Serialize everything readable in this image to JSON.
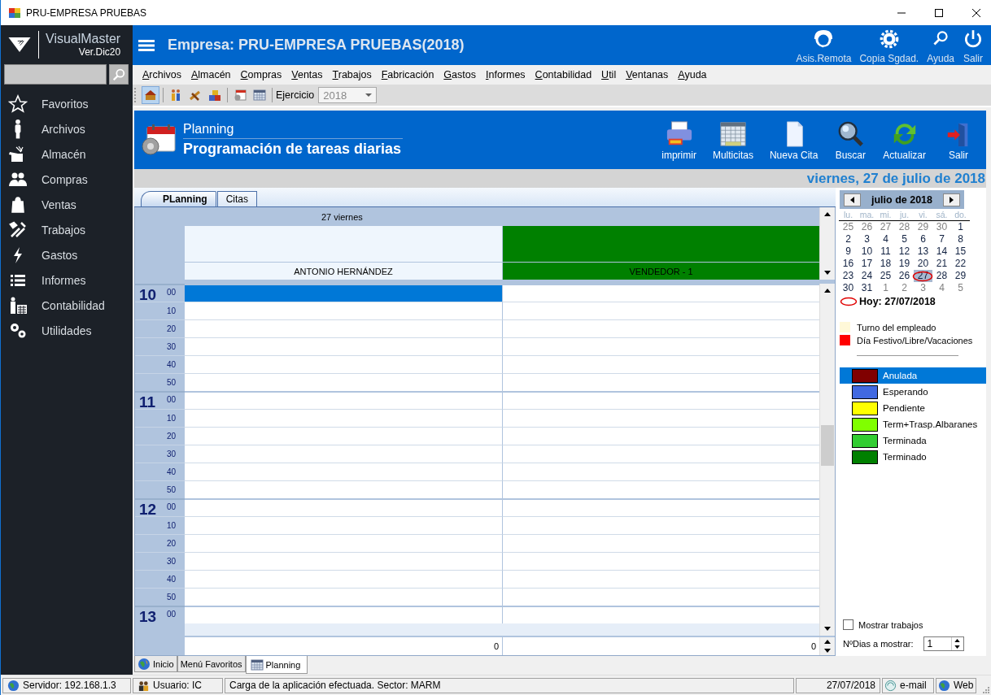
{
  "window": {
    "title": "PRU-EMPRESA PRUEBAS"
  },
  "sidebar": {
    "brand": "VisualMaster",
    "version": "Ver.Dic20",
    "items": [
      {
        "label": "Favoritos"
      },
      {
        "label": "Archivos"
      },
      {
        "label": "Almacén"
      },
      {
        "label": "Compras"
      },
      {
        "label": "Ventas"
      },
      {
        "label": "Trabajos"
      },
      {
        "label": "Gastos"
      },
      {
        "label": "Informes"
      },
      {
        "label": "Contabilidad"
      },
      {
        "label": "Utilidades"
      }
    ]
  },
  "header": {
    "title": "Empresa: PRU-EMPRESA PRUEBAS(2018)",
    "actions": [
      {
        "label": "Asis.Remota"
      },
      {
        "label": "Copia Sgdad."
      },
      {
        "label": "Ayuda"
      },
      {
        "label": "Salir"
      }
    ]
  },
  "menu": [
    "Archivos",
    "Almacén",
    "Compras",
    "Ventas",
    "Trabajos",
    "Fabricación",
    "Gastos",
    "Informes",
    "Contabilidad",
    "Util",
    "Ventanas",
    "Ayuda"
  ],
  "toolbar": {
    "label": "Ejercicio",
    "value": "2018"
  },
  "planning": {
    "subtitle": "Planning",
    "title": "Programación de tareas diarias",
    "date": "viernes, 27 de julio de 2018",
    "actions": [
      {
        "label": "imprimir"
      },
      {
        "label": "Multicitas"
      },
      {
        "label": "Nueva Cita"
      },
      {
        "label": "Buscar"
      },
      {
        "label": "Actualizar"
      },
      {
        "label": "Salir"
      }
    ]
  },
  "tabs": [
    {
      "label": "PLanning",
      "selected": true
    },
    {
      "label": "Citas",
      "selected": false
    }
  ],
  "schedule": {
    "day": "27 viernes",
    "resources": [
      {
        "name": "ANTONIO HERNÁNDEZ",
        "color": "#eff6fd"
      },
      {
        "name": "VENDEDOR - 1",
        "color": "#008000"
      }
    ],
    "hours": [
      {
        "hour": "10",
        "slots": [
          {
            "minute": "00",
            "cells": [
              {
                "selected": true
              },
              {
                "selected": false
              }
            ]
          },
          {
            "minute": "10",
            "cells": [
              {
                "selected": false
              },
              {
                "selected": false
              }
            ]
          },
          {
            "minute": "20",
            "cells": [
              {
                "selected": false
              },
              {
                "selected": false
              }
            ]
          },
          {
            "minute": "30",
            "cells": [
              {
                "selected": false
              },
              {
                "selected": false
              }
            ]
          },
          {
            "minute": "40",
            "cells": [
              {
                "selected": false
              },
              {
                "selected": false
              }
            ]
          },
          {
            "minute": "50",
            "cells": [
              {
                "selected": false
              },
              {
                "selected": false
              }
            ]
          }
        ]
      },
      {
        "hour": "11",
        "slots": [
          {
            "minute": "00",
            "cells": [
              {
                "selected": false
              },
              {
                "selected": false
              }
            ]
          },
          {
            "minute": "10",
            "cells": [
              {
                "selected": false
              },
              {
                "selected": false
              }
            ]
          },
          {
            "minute": "20",
            "cells": [
              {
                "selected": false
              },
              {
                "selected": false
              }
            ]
          },
          {
            "minute": "30",
            "cells": [
              {
                "selected": false
              },
              {
                "selected": false
              }
            ]
          },
          {
            "minute": "40",
            "cells": [
              {
                "selected": false
              },
              {
                "selected": false
              }
            ]
          },
          {
            "minute": "50",
            "cells": [
              {
                "selected": false
              },
              {
                "selected": false
              }
            ]
          }
        ]
      },
      {
        "hour": "12",
        "slots": [
          {
            "minute": "00",
            "cells": [
              {
                "selected": false
              },
              {
                "selected": false
              }
            ]
          },
          {
            "minute": "10",
            "cells": [
              {
                "selected": false
              },
              {
                "selected": false
              }
            ]
          },
          {
            "minute": "20",
            "cells": [
              {
                "selected": false
              },
              {
                "selected": false
              }
            ]
          },
          {
            "minute": "30",
            "cells": [
              {
                "selected": false
              },
              {
                "selected": false
              }
            ]
          },
          {
            "minute": "40",
            "cells": [
              {
                "selected": false
              },
              {
                "selected": false
              }
            ]
          },
          {
            "minute": "50",
            "cells": [
              {
                "selected": false
              },
              {
                "selected": false
              }
            ]
          }
        ]
      },
      {
        "hour": "13",
        "slots": [
          {
            "minute": "00",
            "cells": [
              {
                "selected": false
              },
              {
                "selected": false
              }
            ]
          }
        ]
      }
    ],
    "totals": [
      "0",
      "0"
    ]
  },
  "calendar": {
    "month": "julio de 2018",
    "weekdays": [
      "lu.",
      "ma.",
      "mi.",
      "ju.",
      "vi.",
      "sá.",
      "do."
    ],
    "weeks": [
      [
        {
          "d": "25",
          "outside": true,
          "selected": false,
          "today": false
        },
        {
          "d": "26",
          "outside": true,
          "selected": false,
          "today": false
        },
        {
          "d": "27",
          "outside": true,
          "selected": false,
          "today": false
        },
        {
          "d": "28",
          "outside": true,
          "selected": false,
          "today": false
        },
        {
          "d": "29",
          "outside": true,
          "selected": false,
          "today": false
        },
        {
          "d": "30",
          "outside": true,
          "selected": false,
          "today": false
        },
        {
          "d": "1",
          "outside": false,
          "selected": false,
          "today": false
        }
      ],
      [
        {
          "d": "2",
          "outside": false,
          "selected": false,
          "today": false
        },
        {
          "d": "3",
          "outside": false,
          "selected": false,
          "today": false
        },
        {
          "d": "4",
          "outside": false,
          "selected": false,
          "today": false
        },
        {
          "d": "5",
          "outside": false,
          "selected": false,
          "today": false
        },
        {
          "d": "6",
          "outside": false,
          "selected": false,
          "today": false
        },
        {
          "d": "7",
          "outside": false,
          "selected": false,
          "today": false
        },
        {
          "d": "8",
          "outside": false,
          "selected": false,
          "today": false
        }
      ],
      [
        {
          "d": "9",
          "outside": false,
          "selected": false,
          "today": false
        },
        {
          "d": "10",
          "outside": false,
          "selected": false,
          "today": false
        },
        {
          "d": "11",
          "outside": false,
          "selected": false,
          "today": false
        },
        {
          "d": "12",
          "outside": false,
          "selected": false,
          "today": false
        },
        {
          "d": "13",
          "outside": false,
          "selected": false,
          "today": false
        },
        {
          "d": "14",
          "outside": false,
          "selected": false,
          "today": false
        },
        {
          "d": "15",
          "outside": false,
          "selected": false,
          "today": false
        }
      ],
      [
        {
          "d": "16",
          "outside": false,
          "selected": false,
          "today": false
        },
        {
          "d": "17",
          "outside": false,
          "selected": false,
          "today": false
        },
        {
          "d": "18",
          "outside": false,
          "selected": false,
          "today": false
        },
        {
          "d": "19",
          "outside": false,
          "selected": false,
          "today": false
        },
        {
          "d": "20",
          "outside": false,
          "selected": false,
          "today": false
        },
        {
          "d": "21",
          "outside": false,
          "selected": false,
          "today": false
        },
        {
          "d": "22",
          "outside": false,
          "selected": false,
          "today": false
        }
      ],
      [
        {
          "d": "23",
          "outside": false,
          "selected": false,
          "today": false
        },
        {
          "d": "24",
          "outside": false,
          "selected": false,
          "today": false
        },
        {
          "d": "25",
          "outside": false,
          "selected": false,
          "today": false
        },
        {
          "d": "26",
          "outside": false,
          "selected": false,
          "today": false
        },
        {
          "d": "27",
          "outside": false,
          "selected": true,
          "today": true
        },
        {
          "d": "28",
          "outside": false,
          "selected": false,
          "today": false
        },
        {
          "d": "29",
          "outside": false,
          "selected": false,
          "today": false
        }
      ],
      [
        {
          "d": "30",
          "outside": false,
          "selected": false,
          "today": false
        },
        {
          "d": "31",
          "outside": false,
          "selected": false,
          "today": false
        },
        {
          "d": "1",
          "outside": true,
          "selected": false,
          "today": false
        },
        {
          "d": "2",
          "outside": true,
          "selected": false,
          "today": false
        },
        {
          "d": "3",
          "outside": true,
          "selected": false,
          "today": false
        },
        {
          "d": "4",
          "outside": true,
          "selected": false,
          "today": false
        },
        {
          "d": "5",
          "outside": true,
          "selected": false,
          "today": false
        }
      ]
    ],
    "today": "Hoy: 27/07/2018"
  },
  "legend": [
    {
      "label": "Turno del empleado",
      "color": "#fff8d8"
    },
    {
      "label": "Día Festivo/Libre/Vacaciones",
      "color": "#ff0000"
    }
  ],
  "statuses": [
    {
      "label": "Anulada",
      "color": "#800000",
      "selected": true
    },
    {
      "label": "Esperando",
      "color": "#4169e1",
      "selected": false
    },
    {
      "label": "Pendiente",
      "color": "#ffff00",
      "selected": false
    },
    {
      "label": "Term+Trasp.Albaranes",
      "color": "#80ff00",
      "selected": false
    },
    {
      "label": "Terminada",
      "color": "#32cd32",
      "selected": false
    },
    {
      "label": "Terminado",
      "color": "#008000",
      "selected": false
    }
  ],
  "options": {
    "show_jobs": {
      "label": "Mostrar trabajos",
      "checked": false
    },
    "days": {
      "label": "NºDias a mostrar:",
      "value": "1"
    }
  },
  "window_tabs": [
    {
      "label": "Inicio",
      "selected": false
    },
    {
      "label": "Menú Favoritos",
      "selected": false
    },
    {
      "label": "Planning",
      "selected": true
    }
  ],
  "status_bar": [
    "Servidor: 192.168.1.3",
    "Usuario: IC",
    "Carga de la aplicación efectuada. Sector: MARM",
    "27/07/2018",
    "e-mail",
    "Web"
  ]
}
